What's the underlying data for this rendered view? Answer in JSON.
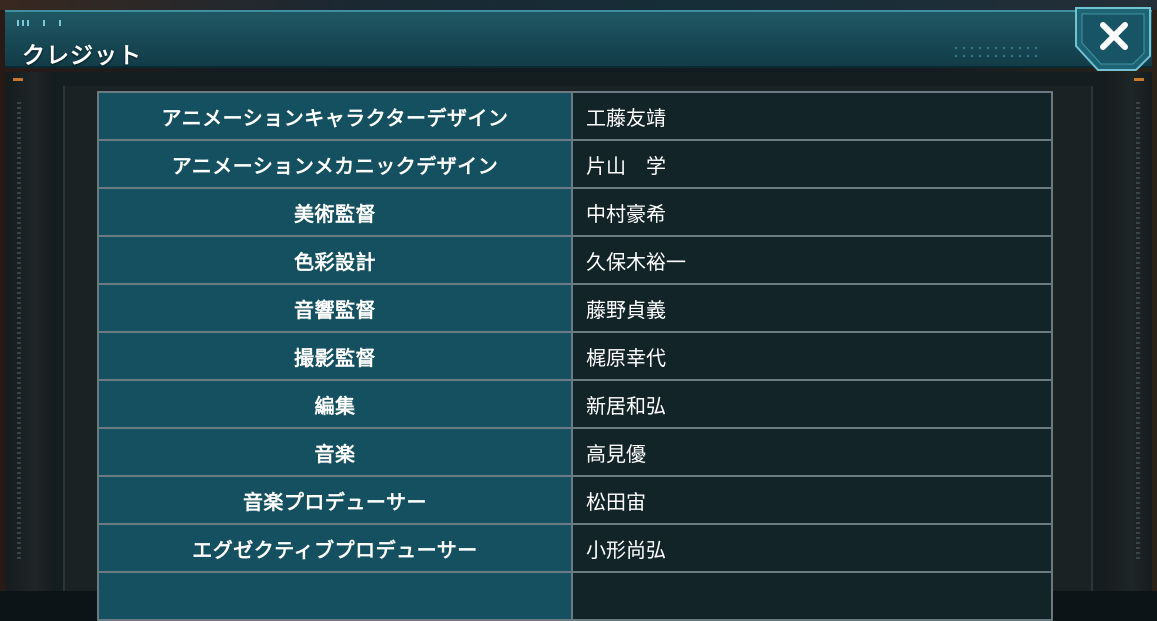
{
  "dialog": {
    "title": "クレジット",
    "close_icon": "close-x-icon"
  },
  "colors": {
    "titlebar": "#184a56",
    "role_cell": "#14505f",
    "name_cell": "#122428",
    "grid_line": "#6a7a80",
    "accent": "#c8782c"
  },
  "credits": [
    {
      "role": "アニメーションキャラクターデザイン",
      "name": "工藤友靖"
    },
    {
      "role": "アニメーションメカニックデザイン",
      "name": "片山　学"
    },
    {
      "role": "美術監督",
      "name": "中村豪希"
    },
    {
      "role": "色彩設計",
      "name": "久保木裕一"
    },
    {
      "role": "音響監督",
      "name": "藤野貞義"
    },
    {
      "role": "撮影監督",
      "name": "梶原幸代"
    },
    {
      "role": "編集",
      "name": "新居和弘"
    },
    {
      "role": "音楽",
      "name": "高見優"
    },
    {
      "role": "音楽プロデューサー",
      "name": "松田宙"
    },
    {
      "role": "エグゼクティブプロデューサー",
      "name": "小形尚弘"
    }
  ]
}
